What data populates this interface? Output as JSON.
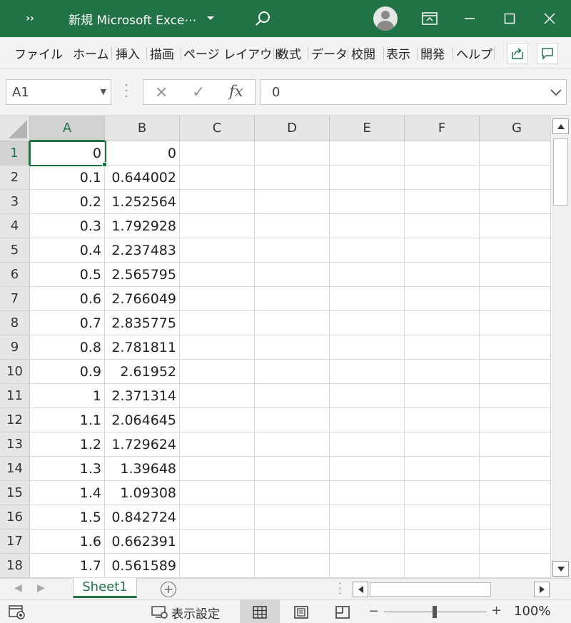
{
  "titlebar": {
    "qat": "››",
    "title": "新規 Microsoft Exce⋯",
    "icons": [
      "chevron-down-icon",
      "search-icon",
      "avatar",
      "ribbon-display-icon",
      "minimize-icon",
      "maximize-icon",
      "close-icon"
    ]
  },
  "menu": {
    "tabs": [
      "ファイル",
      "ホーム",
      "挿入",
      "描画",
      "ページ レイアウト",
      "数式",
      "データ",
      "校閲",
      "表示",
      "開発",
      "ヘルプ"
    ]
  },
  "formula_bar": {
    "name_box": "A1",
    "formula": "0"
  },
  "columns": [
    "A",
    "B",
    "C",
    "D",
    "E",
    "F",
    "G"
  ],
  "rows": [
    {
      "n": "1",
      "a": "0",
      "b": "0"
    },
    {
      "n": "2",
      "a": "0.1",
      "b": "0.644002"
    },
    {
      "n": "3",
      "a": "0.2",
      "b": "1.252564"
    },
    {
      "n": "4",
      "a": "0.3",
      "b": "1.792928"
    },
    {
      "n": "5",
      "a": "0.4",
      "b": "2.237483"
    },
    {
      "n": "6",
      "a": "0.5",
      "b": "2.565795"
    },
    {
      "n": "7",
      "a": "0.6",
      "b": "2.766049"
    },
    {
      "n": "8",
      "a": "0.7",
      "b": "2.835775"
    },
    {
      "n": "9",
      "a": "0.8",
      "b": "2.781811"
    },
    {
      "n": "10",
      "a": "0.9",
      "b": "2.61952"
    },
    {
      "n": "11",
      "a": "1",
      "b": "2.371314"
    },
    {
      "n": "12",
      "a": "1.1",
      "b": "2.064645"
    },
    {
      "n": "13",
      "a": "1.2",
      "b": "1.729624"
    },
    {
      "n": "14",
      "a": "1.3",
      "b": "1.39648"
    },
    {
      "n": "15",
      "a": "1.4",
      "b": "1.09308"
    },
    {
      "n": "16",
      "a": "1.5",
      "b": "0.842724"
    },
    {
      "n": "17",
      "a": "1.6",
      "b": "0.662391"
    },
    {
      "n": "18",
      "a": "1.7",
      "b": "0.561589"
    }
  ],
  "sheets": {
    "tabs": [
      "Sheet1"
    ]
  },
  "status": {
    "display_settings": "表示設定",
    "zoom": "100%",
    "zoom_out": "−",
    "zoom_in": "+"
  },
  "colors": {
    "accent": "#217346"
  }
}
